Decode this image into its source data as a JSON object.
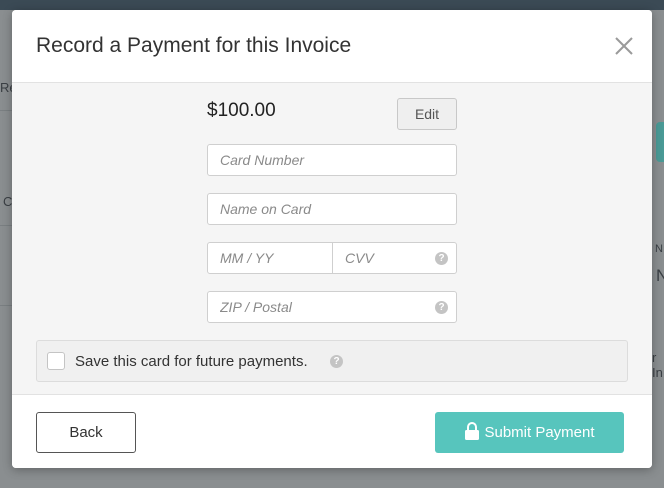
{
  "modal": {
    "title": "Record a Payment for this Invoice",
    "amount": "$100.00",
    "edit_label": "Edit",
    "fields": {
      "card_number_placeholder": "Card Number",
      "name_on_card_placeholder": "Name on Card",
      "expiry_placeholder": "MM / YY",
      "cvv_placeholder": "CVV",
      "zip_placeholder": "ZIP / Postal"
    },
    "save_card_label": "Save this card for future payments.",
    "save_card_checked": false,
    "back_label": "Back",
    "submit_label": "Submit Payment",
    "help_icon_glyph": "?"
  },
  "icons": {
    "close": "close-icon",
    "help": "question-circle-icon",
    "lock": "lock-icon"
  },
  "colors": {
    "submit_button": "#57c5bd",
    "backdrop": "#8a8e90"
  },
  "background": {
    "fragment_1": "Re",
    "fragment_2": "C",
    "fragment_3": "N",
    "fragment_4": "N",
    "fragment_5": "r In"
  }
}
